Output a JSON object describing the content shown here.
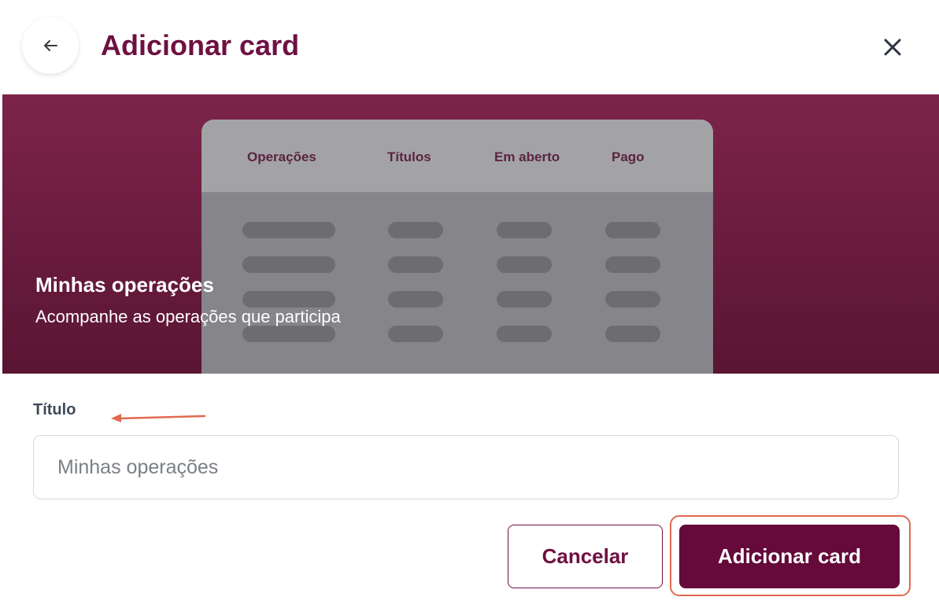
{
  "header": {
    "title": "Adicionar card",
    "back_icon": "arrow-left-icon",
    "close_icon": "close-icon"
  },
  "hero": {
    "title": "Minhas operações",
    "description": "Acompanhe as operações que participa",
    "preview_columns": [
      "Operações",
      "Títulos",
      "Em aberto",
      "Pago"
    ],
    "colors": {
      "gradient_top": "#7c2449",
      "gradient_bottom": "#5a1533"
    }
  },
  "form": {
    "title_label": "Título",
    "title_placeholder": "Minhas operações"
  },
  "actions": {
    "cancel_label": "Cancelar",
    "add_label": "Adicionar card"
  },
  "colors": {
    "accent": "#650a3a",
    "annotation": "#e06a50"
  }
}
